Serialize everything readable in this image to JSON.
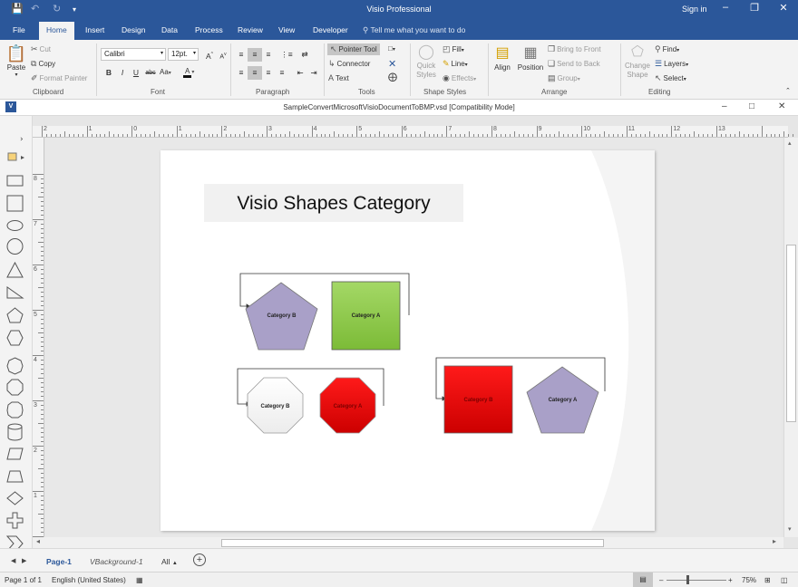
{
  "app": {
    "title": "Visio Professional",
    "sign_in": "Sign in"
  },
  "tabs": [
    "File",
    "Home",
    "Insert",
    "Design",
    "Data",
    "Process",
    "Review",
    "View",
    "Developer"
  ],
  "tell_me": "Tell me what you want to do",
  "ribbon": {
    "clipboard": {
      "label": "Clipboard",
      "paste": "Paste",
      "cut": "Cut",
      "copy": "Copy",
      "format_painter": "Format Painter"
    },
    "font": {
      "label": "Font",
      "family": "Calibri",
      "size": "12pt.",
      "grow": "A",
      "shrink": "A",
      "bold": "B",
      "italic": "I",
      "underline": "U",
      "strike": "abc",
      "case": "Aa",
      "color": "A"
    },
    "paragraph": {
      "label": "Paragraph"
    },
    "tools": {
      "label": "Tools",
      "pointer": "Pointer Tool",
      "connector": "Connector",
      "text": "Text"
    },
    "shape_styles": {
      "label": "Shape Styles",
      "quick_styles": "Quick Styles",
      "fill": "Fill",
      "line": "Line",
      "effects": "Effects"
    },
    "arrange": {
      "label": "Arrange",
      "align": "Align",
      "position": "Position",
      "bring_front": "Bring to Front",
      "send_back": "Send to Back",
      "group": "Group"
    },
    "editing": {
      "label": "Editing",
      "change_shape": "Change Shape",
      "find": "Find",
      "layers": "Layers",
      "select": "Select"
    }
  },
  "document": {
    "title": "SampleConvertMicrosoftVisioDocumentToBMP.vsd  [Compatibility Mode]"
  },
  "ruler": {
    "h_labels": [
      "2",
      "1",
      "0",
      "1",
      "2",
      "3",
      "4",
      "5",
      "6",
      "7",
      "8",
      "9",
      "10",
      "11",
      "12",
      "13"
    ],
    "v_labels": [
      "8",
      "7",
      "6",
      "5",
      "4",
      "3",
      "2",
      "1",
      "0"
    ]
  },
  "diagram": {
    "title": "Visio Shapes Category",
    "shape_labels": {
      "g1_pentagon": "Category B",
      "g1_square": "Category A",
      "g2_octagon_white": "Category B",
      "g2_octagon_red": "Category A",
      "g3_square_red": "Category B",
      "g3_pentagon": "Category A"
    },
    "colors": {
      "lavender": "#a9a0c8",
      "green": "#8cc94a",
      "red": "#e60000",
      "white": "#f7f7f7"
    }
  },
  "page_tabs": {
    "active": "Page-1",
    "background": "VBackground-1",
    "all": "All"
  },
  "status": {
    "page": "Page 1 of 1",
    "language": "English (United States)",
    "zoom": "75%"
  }
}
